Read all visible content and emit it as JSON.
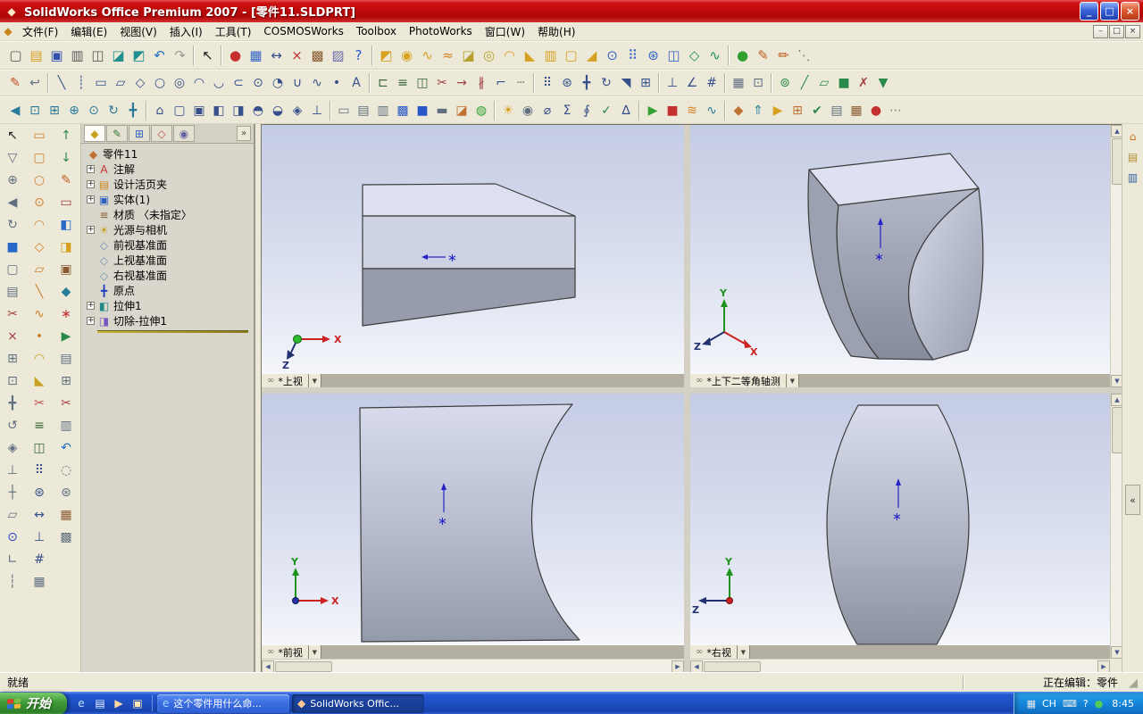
{
  "window": {
    "title": "SolidWorks Office Premium 2007 - [零件11.SLDPRT]",
    "controls": {
      "minimize": "_",
      "maximize": "□",
      "close": "×"
    },
    "doc_controls": {
      "minimize": "–",
      "restore": "□",
      "close": "×"
    }
  },
  "menu": {
    "items": [
      {
        "id": "file",
        "label": "文件(F)"
      },
      {
        "id": "edit",
        "label": "编辑(E)"
      },
      {
        "id": "view",
        "label": "视图(V)"
      },
      {
        "id": "insert",
        "label": "插入(I)"
      },
      {
        "id": "tools",
        "label": "工具(T)"
      },
      {
        "id": "cosmosworks",
        "label": "COSMOSWorks"
      },
      {
        "id": "toolbox",
        "label": "Toolbox"
      },
      {
        "id": "photoworks",
        "label": "PhotoWorks"
      },
      {
        "id": "window",
        "label": "窗口(W)"
      },
      {
        "id": "help",
        "label": "帮助(H)"
      }
    ]
  },
  "toolbars": {
    "row1": [
      [
        "new-document",
        "▢",
        "#5a5a5a"
      ],
      [
        "open-document",
        "▤",
        "#d8a020"
      ],
      [
        "save",
        "▣",
        "#3050b0"
      ],
      [
        "print",
        "▥",
        "#5a5a5a"
      ],
      [
        "print-preview",
        "◫",
        "#5a5a5a"
      ],
      [
        "make-drawing",
        "◪",
        "#1f8f8f"
      ],
      [
        "make-assembly",
        "◩",
        "#1f8f8f"
      ],
      [
        "undo",
        "↶",
        "#2070c0"
      ],
      [
        "redo",
        "↷",
        "#9a9a9a"
      ],
      "|",
      [
        "select",
        "↖",
        "#1a1a1a"
      ],
      "|",
      [
        "rebuild",
        "●",
        "#c43030"
      ],
      [
        "edit-appearance",
        "▦",
        "#3565c8"
      ],
      [
        "smart-dimension",
        "↔",
        "#35508a"
      ],
      [
        "delete",
        "×",
        "#c43030"
      ],
      [
        "edit-material",
        "▩",
        "#8a5a30"
      ],
      [
        "texture",
        "▨",
        "#6a6aa8"
      ],
      [
        "help",
        "?",
        "#2858c8"
      ],
      "|",
      [
        "extruded-boss",
        "◩",
        "#d8a020"
      ],
      [
        "revolved-boss",
        "◉",
        "#d8a020"
      ],
      [
        "swept-boss",
        "∿",
        "#d8a020"
      ],
      [
        "lofted-boss",
        "≈",
        "#d88020"
      ],
      [
        "extruded-cut",
        "◪",
        "#b8a030"
      ],
      [
        "revolved-cut",
        "◎",
        "#b8a030"
      ],
      [
        "fillet",
        "◠",
        "#d8a020"
      ],
      [
        "chamfer",
        "◣",
        "#d8a020"
      ],
      [
        "rib",
        "▥",
        "#d8a020"
      ],
      [
        "shell",
        "▢",
        "#d8a020"
      ],
      [
        "draft",
        "◢",
        "#d8a020"
      ],
      [
        "hole-wizard",
        "⊙",
        "#3565c8"
      ],
      [
        "linear-pattern",
        "⠿",
        "#3565c8"
      ],
      [
        "circular-pattern",
        "⊛",
        "#3565c8"
      ],
      [
        "mirror-feature",
        "◫",
        "#3565c8"
      ],
      [
        "reference-geometry",
        "◇",
        "#209060"
      ],
      [
        "curves",
        "∿",
        "#209060"
      ],
      "|",
      [
        "render",
        "●",
        "#30a030"
      ],
      [
        "sketch",
        "✎",
        "#c06020"
      ],
      [
        "3d-sketch",
        "✏",
        "#c06020"
      ],
      [
        "more-commands",
        "⋱",
        "#808080"
      ]
    ],
    "row2": [
      [
        "sketch-pencil",
        "✎",
        "#c05020"
      ],
      [
        "exit-sketch",
        "↩",
        "#607080"
      ],
      "|",
      [
        "line",
        "╲",
        "#35508a"
      ],
      [
        "centerline",
        "┊",
        "#35508a"
      ],
      [
        "rectangle",
        "▭",
        "#35508a"
      ],
      [
        "parallelogram",
        "▱",
        "#35508a"
      ],
      [
        "polygon",
        "◇",
        "#35508a"
      ],
      [
        "circle",
        "○",
        "#35508a"
      ],
      [
        "perimeter-circle",
        "◎",
        "#35508a"
      ],
      [
        "centerpoint-arc",
        "◠",
        "#35508a"
      ],
      [
        "tangent-arc",
        "◡",
        "#35508a"
      ],
      [
        "three-point-arc",
        "⊂",
        "#35508a"
      ],
      [
        "ellipse",
        "⊙",
        "#35508a"
      ],
      [
        "partial-ellipse",
        "◔",
        "#35508a"
      ],
      [
        "parabola",
        "∪",
        "#35508a"
      ],
      [
        "spline",
        "∿",
        "#35508a"
      ],
      [
        "point",
        "•",
        "#35508a"
      ],
      [
        "sketch-text",
        "A",
        "#35508a"
      ],
      "|",
      [
        "convert-entities",
        "⊏",
        "#3a6a3a"
      ],
      [
        "offset-entities",
        "≡",
        "#3a6a3a"
      ],
      [
        "mirror-entities",
        "◫",
        "#3a6a3a"
      ],
      [
        "trim-entities",
        "✂",
        "#a04040"
      ],
      [
        "extend-entities",
        "→",
        "#a04040"
      ],
      [
        "split-entities",
        "∦",
        "#a04040"
      ],
      [
        "jog-line",
        "⌐",
        "#35508a"
      ],
      [
        "construction-geometry",
        "┄",
        "#707070"
      ],
      "|",
      [
        "linear-sketch-pattern",
        "⠿",
        "#35508a"
      ],
      [
        "circular-sketch-pattern",
        "⊛",
        "#35508a"
      ],
      [
        "move-entities",
        "╋",
        "#35508a"
      ],
      [
        "rotate-entities",
        "↻",
        "#35508a"
      ],
      [
        "scale-entities",
        "◥",
        "#35508a"
      ],
      [
        "copy-entities",
        "⊞",
        "#35508a"
      ],
      "|",
      [
        "add-relation",
        "⊥",
        "#35508a"
      ],
      [
        "display-relations",
        "∠",
        "#35508a"
      ],
      [
        "quick-snaps",
        "#",
        "#35508a"
      ],
      "|",
      [
        "grid-settings",
        "▦",
        "#607080"
      ],
      [
        "sketch-settings",
        "⊡",
        "#607080"
      ],
      "|",
      [
        "filter-vertices",
        "⊚",
        "#2a8a4a"
      ],
      [
        "filter-edges",
        "╱",
        "#2a8a4a"
      ],
      [
        "filter-faces",
        "▱",
        "#2a8a4a"
      ],
      [
        "filter-solids",
        "■",
        "#2a8a4a"
      ],
      [
        "clear-filter",
        "✗",
        "#a04040"
      ],
      [
        "toggle-filter",
        "▼",
        "#2a8a4a"
      ]
    ],
    "row3": [
      [
        "view-previous",
        "◀",
        "#2a7a9a"
      ],
      [
        "zoom-to-fit",
        "⊡",
        "#2a7a9a"
      ],
      [
        "zoom-to-area",
        "⊞",
        "#2a7a9a"
      ],
      [
        "zoom-in-out",
        "⊕",
        "#2a7a9a"
      ],
      [
        "zoom-to-selection",
        "⊙",
        "#2a7a9a"
      ],
      [
        "rotate-view",
        "↻",
        "#2a7a9a"
      ],
      [
        "pan",
        "╋",
        "#2a7a9a"
      ],
      "|",
      [
        "standard-views",
        "⌂",
        "#35508a"
      ],
      [
        "front-view",
        "▢",
        "#35508a"
      ],
      [
        "back-view",
        "▣",
        "#35508a"
      ],
      [
        "left-view",
        "◧",
        "#35508a"
      ],
      [
        "right-view",
        "◨",
        "#35508a"
      ],
      [
        "top-view",
        "◓",
        "#35508a"
      ],
      [
        "bottom-view",
        "◒",
        "#35508a"
      ],
      [
        "isometric-view",
        "◈",
        "#35508a"
      ],
      [
        "normal-to",
        "⊥",
        "#35508a"
      ],
      "|",
      [
        "wireframe",
        "▭",
        "#607080"
      ],
      [
        "hidden-lines-visible",
        "▤",
        "#607080"
      ],
      [
        "hidden-lines-removed",
        "▥",
        "#607080"
      ],
      [
        "shaded-with-edges",
        "▩",
        "#2858c8"
      ],
      [
        "shaded",
        "■",
        "#2858c8"
      ],
      [
        "shadows-in-shaded",
        "▬",
        "#607080"
      ],
      [
        "section-view",
        "◪",
        "#c07030"
      ],
      [
        "realview-graphics",
        "◍",
        "#30a030"
      ],
      "|",
      [
        "lights",
        "☀",
        "#d8a020"
      ],
      [
        "camera-views",
        "◉",
        "#607080"
      ],
      [
        "measure",
        "⌀",
        "#35508a"
      ],
      [
        "mass-properties",
        "Σ",
        "#35508a"
      ],
      [
        "section-properties",
        "∮",
        "#35508a"
      ],
      [
        "check-entity",
        "✓",
        "#2a8a4a"
      ],
      [
        "deviation-analysis",
        "∆",
        "#35508a"
      ],
      "|",
      [
        "cosmos-run",
        "▶",
        "#30a030"
      ],
      [
        "cosmos-stop",
        "■",
        "#c43030"
      ],
      [
        "cosmos-plot",
        "≋",
        "#d88020"
      ],
      [
        "flow-simulation",
        "∿",
        "#2a7a9a"
      ],
      "|",
      [
        "edrawings-publish",
        "◆",
        "#c07030"
      ],
      [
        "3d-instant-website",
        "⇑",
        "#2a7a9a"
      ],
      [
        "animator",
        "▶",
        "#d8a020"
      ],
      [
        "toolbox-browser",
        "⊞",
        "#c07030"
      ],
      [
        "design-checker",
        "✔",
        "#2a8a4a"
      ],
      [
        "task-scheduler",
        "▤",
        "#607080"
      ],
      [
        "macro-run",
        "▦",
        "#8a5a30"
      ],
      [
        "macro-record",
        "●",
        "#c43030"
      ],
      [
        "customize-menu",
        "⋯",
        "#808080"
      ]
    ],
    "left1": [
      [
        "select-arrow",
        "↖",
        "#202020"
      ],
      [
        "selection-filter-bar",
        "▽",
        "#607080"
      ],
      [
        "magnifying-glass",
        "⊕",
        "#607080"
      ],
      [
        "previous-view-side",
        "◀",
        "#607080"
      ],
      [
        "redraw",
        "↻",
        "#607080"
      ],
      [
        "shaded-cube",
        "■",
        "#2868c8"
      ],
      [
        "wireframe-cube",
        "▢",
        "#607080"
      ],
      [
        "hidden-lines-cube",
        "▤",
        "#607080"
      ],
      [
        "scissors",
        "✂",
        "#a04040"
      ],
      [
        "delete-item",
        "×",
        "#a04040"
      ],
      [
        "zoom-window-side",
        "⊞",
        "#607080"
      ],
      [
        "zoom-fit-side",
        "⊡",
        "#607080"
      ],
      [
        "pan-side",
        "╋",
        "#607080"
      ],
      [
        "rotate-side",
        "↺",
        "#607080"
      ],
      [
        "view-orientation-cube",
        "◈",
        "#607080"
      ],
      [
        "normal-to-side",
        "⊥",
        "#607080"
      ],
      [
        "axis-display",
        "┼",
        "#607080"
      ],
      [
        "plane-display",
        "▱",
        "#607080"
      ],
      [
        "origin-display",
        "⊙",
        "#2040c0"
      ],
      [
        "coordinate-system",
        "∟",
        "#607080"
      ],
      [
        "temporary-axes",
        "┆",
        "#607080"
      ]
    ],
    "left2": [
      [
        "rectangle-side",
        "▭",
        "#d08030"
      ],
      [
        "rounded-rectangle-side",
        "▢",
        "#d08030"
      ],
      [
        "circle-side",
        "○",
        "#d08030"
      ],
      [
        "ellipse-side",
        "⊙",
        "#d08030"
      ],
      [
        "arc-side",
        "◠",
        "#d08030"
      ],
      [
        "polygon-side",
        "◇",
        "#d08030"
      ],
      [
        "slot-side",
        "▱",
        "#d08030"
      ],
      [
        "line-side",
        "╲",
        "#d08030"
      ],
      [
        "spline-side",
        "∿",
        "#d08030"
      ],
      [
        "point-side",
        "•",
        "#d08030"
      ],
      [
        "fillet-side",
        "◠",
        "#c8a020"
      ],
      [
        "chamfer-side",
        "◣",
        "#c8a020"
      ],
      [
        "trim-side",
        "✂",
        "#c05050"
      ],
      [
        "offset-side",
        "≡",
        "#3a6a3a"
      ],
      [
        "mirror-side",
        "◫",
        "#3a6a3a"
      ],
      [
        "linear-pattern-side",
        "⠿",
        "#35508a"
      ],
      [
        "circular-pattern-side",
        "⊛",
        "#35508a"
      ],
      [
        "dimension-side",
        "↔",
        "#35508a"
      ],
      [
        "relation-side",
        "⊥",
        "#35508a"
      ],
      [
        "snap-side",
        "#",
        "#35508a"
      ],
      [
        "grid-side",
        "▦",
        "#607080"
      ]
    ],
    "left3": [
      [
        "move-up-tree",
        "↑",
        "#2a8a4a"
      ],
      [
        "move-down-tree",
        "↓",
        "#2a8a4a"
      ],
      [
        "pencil-side",
        "✎",
        "#c06020"
      ],
      [
        "eraser-side",
        "▭",
        "#a04040"
      ],
      [
        "paint-left-side",
        "◧",
        "#2868c8"
      ],
      [
        "paint-right-side",
        "◨",
        "#d8a020"
      ],
      [
        "stamp-side",
        "▣",
        "#8a5a30"
      ],
      [
        "gem-side",
        "◆",
        "#2a7a9a"
      ],
      [
        "pin-side",
        "∗",
        "#c43030"
      ],
      [
        "play-side",
        "▶",
        "#2a8a4a"
      ],
      [
        "layers-side",
        "▤",
        "#607080"
      ],
      [
        "copy-side",
        "⊞",
        "#607080"
      ],
      [
        "cut-side",
        "✂",
        "#a04040"
      ],
      [
        "paste-side",
        "▥",
        "#607080"
      ],
      [
        "undo-side",
        "↶",
        "#2070c0"
      ],
      [
        "lasso-side",
        "◌",
        "#607080"
      ],
      [
        "gear-side",
        "⊛",
        "#607080"
      ],
      [
        "swatch-side",
        "▦",
        "#8a5a30"
      ],
      [
        "checker-side",
        "▩",
        "#607080"
      ]
    ]
  },
  "feature_panel": {
    "tabs": [
      {
        "id": "feature-manager",
        "glyph": "◆",
        "color": "#c8a020"
      },
      {
        "id": "property-manager",
        "glyph": "✎",
        "color": "#3a7a3a"
      },
      {
        "id": "configuration-manager",
        "glyph": "⊞",
        "color": "#3060c0"
      },
      {
        "id": "dimxpert-manager",
        "glyph": "◇",
        "color": "#c05050"
      },
      {
        "id": "display-manager",
        "glyph": "◉",
        "color": "#6060a0"
      }
    ],
    "collapse_glyph": "»",
    "tree": {
      "root": {
        "label": "零件11"
      },
      "items": [
        {
          "label": "注解",
          "icon": "annotations",
          "expand": true
        },
        {
          "label": "设计活页夹",
          "icon": "design-binder",
          "expand": true
        },
        {
          "label": "实体(1)",
          "icon": "solid-bodies",
          "expand": true
        },
        {
          "label": "材质 〈未指定〉",
          "icon": "material",
          "expand": false
        },
        {
          "label": "光源与相机",
          "icon": "lights-cameras",
          "expand": true
        },
        {
          "label": "前视基准面",
          "icon": "plane",
          "expand": false
        },
        {
          "label": "上视基准面",
          "icon": "plane",
          "expand": false
        },
        {
          "label": "右视基准面",
          "icon": "plane",
          "expand": false
        },
        {
          "label": "原点",
          "icon": "origin",
          "expand": false
        },
        {
          "label": "拉伸1",
          "icon": "extrude",
          "expand": true
        },
        {
          "label": "切除-拉伸1",
          "icon": "cut-extrude",
          "expand": true
        }
      ]
    }
  },
  "viewports": [
    {
      "id": "top",
      "label": "*上视",
      "axes": {
        "x": "X",
        "z": "Z"
      }
    },
    {
      "id": "isometric",
      "label": "*上下二等角轴测",
      "axes": {
        "x": "X",
        "y": "Y",
        "z": "Z"
      }
    },
    {
      "id": "front",
      "label": "*前视",
      "axes": {
        "x": "X",
        "y": "Y"
      }
    },
    {
      "id": "right",
      "label": "*右视",
      "axes": {
        "y": "Y",
        "z": "Z"
      }
    }
  ],
  "task_pane": {
    "tabs": [
      {
        "id": "solidworks-resources",
        "glyph": "⌂",
        "color": "#d07020"
      },
      {
        "id": "design-library",
        "glyph": "▤",
        "color": "#b09030"
      },
      {
        "id": "file-explorer",
        "glyph": "▥",
        "color": "#3060a0"
      }
    ],
    "collapse_glyph": "«"
  },
  "status_bar": {
    "left": "就绪",
    "right": "正在编辑：零件"
  },
  "taskbar": {
    "start_label": "开始",
    "quick_launch": [
      {
        "id": "internet-explorer",
        "glyph": "e",
        "color": "#bfe0ff"
      },
      {
        "id": "show-desktop",
        "glyph": "▤",
        "color": "#e8f0ff"
      },
      {
        "id": "media-player",
        "glyph": "▶",
        "color": "#ffd9a0"
      },
      {
        "id": "outlook",
        "glyph": "▣",
        "color": "#ffe9b0"
      }
    ],
    "windows": [
      {
        "id": "browser-window",
        "icon": "internet-explorer-icon",
        "glyph": "e",
        "glyph_color": "#9fd4ff",
        "label": "这个零件用什么命...",
        "active": false
      },
      {
        "id": "solidworks-window",
        "icon": "solidworks-icon",
        "glyph": "◆",
        "glyph_color": "#ffc890",
        "label": "SolidWorks Offic...",
        "active": true
      }
    ],
    "tray": {
      "items": [
        {
          "id": "app-status",
          "glyph": "▦",
          "color": "#e8e8e8"
        },
        {
          "id": "language-indicator",
          "glyph": "CH",
          "color": "#ffffff"
        },
        {
          "id": "keyboard",
          "glyph": "⌨",
          "color": "#e8e8e8"
        },
        {
          "id": "help-center",
          "glyph": "?",
          "color": "#ffffff"
        },
        {
          "id": "green-status",
          "glyph": "●",
          "color": "#55cc55"
        }
      ],
      "time": "8:45"
    }
  }
}
